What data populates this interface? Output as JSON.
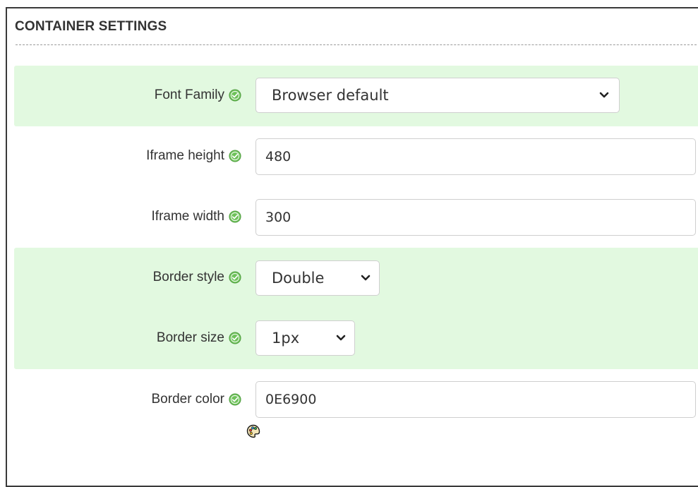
{
  "section": {
    "title": "CONTAINER SETTINGS"
  },
  "settings": [
    {
      "label": "Font Family",
      "type": "select",
      "value": "Browser default",
      "highlighted": true,
      "status_icon": "check-circle-icon"
    },
    {
      "label": "Iframe height",
      "type": "text",
      "value": "480",
      "highlighted": false,
      "status_icon": "check-circle-icon"
    },
    {
      "label": "Iframe width",
      "type": "text",
      "value": "300",
      "highlighted": false,
      "status_icon": "check-circle-icon"
    },
    {
      "label": "Border style",
      "type": "select",
      "value": "Double",
      "highlighted": true,
      "status_icon": "check-circle-icon"
    },
    {
      "label": "Border size",
      "type": "select",
      "value": "1px",
      "highlighted": true,
      "status_icon": "check-circle-icon"
    },
    {
      "label": "Border color",
      "type": "text",
      "value": "0E6900",
      "highlighted": false,
      "status_icon": "check-circle-icon",
      "extra_icon": "color-palette-icon"
    }
  ],
  "colors": {
    "highlight": "#e2f9e0",
    "check": "#6ec25a",
    "text": "#333333"
  }
}
